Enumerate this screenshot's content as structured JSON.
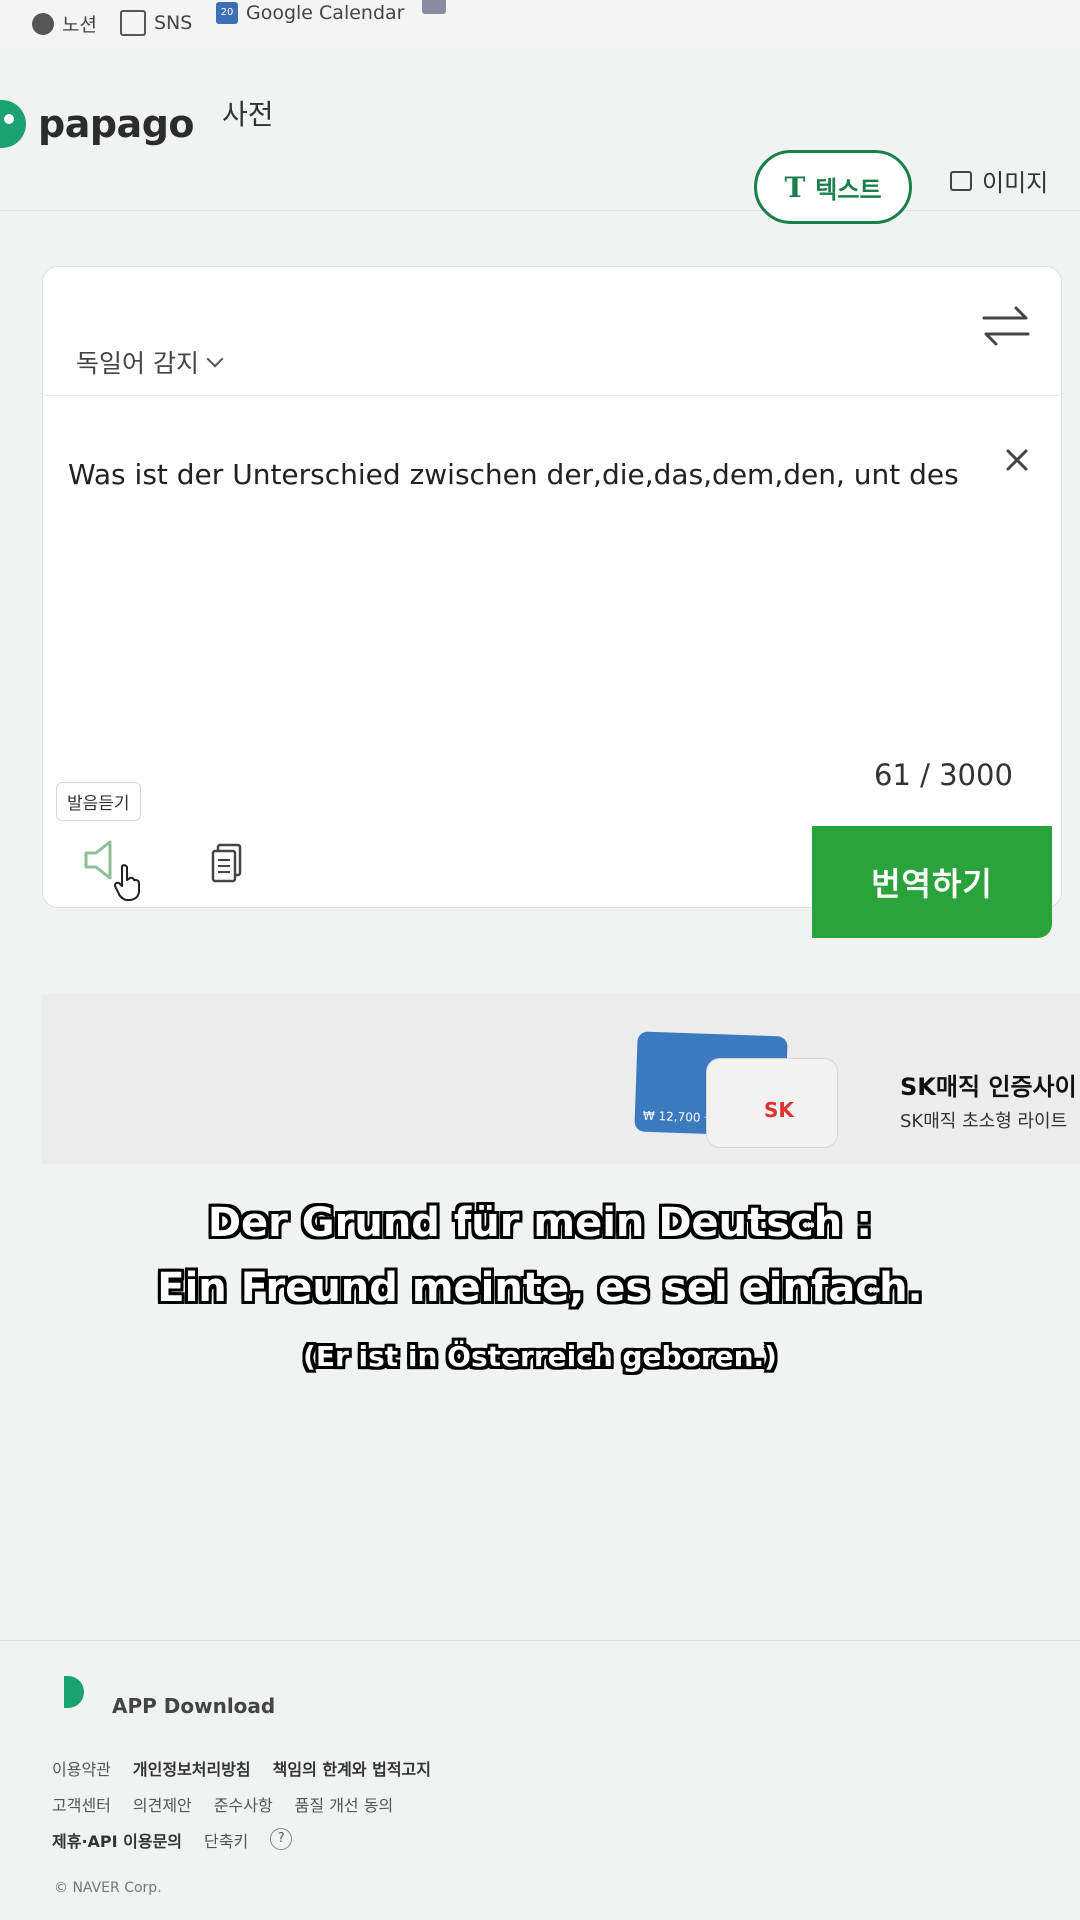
{
  "bookmarks": [
    {
      "label": "노션",
      "icon": "globe-icon"
    },
    {
      "label": "SNS",
      "icon": "folder-icon"
    },
    {
      "label": "Google Calendar",
      "icon": "calendar-icon"
    }
  ],
  "header": {
    "logo_text": "papago",
    "dictionary_link": "사전"
  },
  "mode_tabs": {
    "text_icon": "T",
    "text_label": "텍스트",
    "image_label": "이미지"
  },
  "translator": {
    "source_language": "독일어 감지",
    "source_text": "Was ist der Unterschied zwischen der,die,das,dem,den, unt des",
    "char_count": "61 / 3000",
    "tooltip": "발음듣기",
    "translate_button": "번역하기"
  },
  "ad": {
    "price": "₩ 12,700 원",
    "brand": "SK",
    "title": "SK매직 인증사이",
    "subtitle": "SK매직 초소형 라이트"
  },
  "overlay_subtitles": {
    "line1": "Der Grund für mein Deutsch :",
    "line2": "Ein Freund meinte, es sei einfach.",
    "line3": "(Er ist in Österreich geboren.)"
  },
  "footer": {
    "app_download": "APP Download",
    "row1": [
      "이용약관",
      "개인정보처리방침",
      "책임의 한계와 법적고지"
    ],
    "row2": [
      "고객센터",
      "의견제안",
      "준수사항",
      "품질 개선 동의"
    ],
    "row3": [
      "제휴·API 이용문의",
      "단축키"
    ],
    "help": "?",
    "copyright": "© NAVER Corp."
  },
  "colors": {
    "brand_green": "#1aa371",
    "tab_green": "#1a7f4b",
    "translate_button": "#2aa33d"
  }
}
